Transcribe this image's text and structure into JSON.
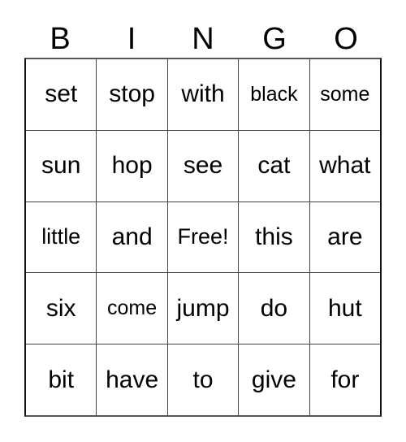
{
  "card": {
    "title": "BINGO",
    "header_letters": [
      "B",
      "I",
      "N",
      "G",
      "O"
    ],
    "free_space_label": "Free!",
    "colors": {
      "background": "#ffffff",
      "text": "#000000",
      "grid_line": "#444444",
      "border": "#111111"
    },
    "grid": {
      "columns": 5,
      "rows": 5,
      "cells": [
        [
          {
            "text": "set",
            "size": "normal"
          },
          {
            "text": "stop",
            "size": "normal"
          },
          {
            "text": "with",
            "size": "normal"
          },
          {
            "text": "black",
            "size": "small"
          },
          {
            "text": "some",
            "size": "small"
          }
        ],
        [
          {
            "text": "sun",
            "size": "normal"
          },
          {
            "text": "hop",
            "size": "normal"
          },
          {
            "text": "see",
            "size": "normal"
          },
          {
            "text": "cat",
            "size": "normal"
          },
          {
            "text": "what",
            "size": "normal"
          }
        ],
        [
          {
            "text": "little",
            "size": "medium"
          },
          {
            "text": "and",
            "size": "normal"
          },
          {
            "text": "Free!",
            "size": "medium"
          },
          {
            "text": "this",
            "size": "normal"
          },
          {
            "text": "are",
            "size": "normal"
          }
        ],
        [
          {
            "text": "six",
            "size": "normal"
          },
          {
            "text": "come",
            "size": "small"
          },
          {
            "text": "jump",
            "size": "normal"
          },
          {
            "text": "do",
            "size": "normal"
          },
          {
            "text": "hut",
            "size": "normal"
          }
        ],
        [
          {
            "text": "bit",
            "size": "normal"
          },
          {
            "text": "have",
            "size": "normal"
          },
          {
            "text": "to",
            "size": "normal"
          },
          {
            "text": "give",
            "size": "normal"
          },
          {
            "text": "for",
            "size": "normal"
          }
        ]
      ]
    }
  }
}
